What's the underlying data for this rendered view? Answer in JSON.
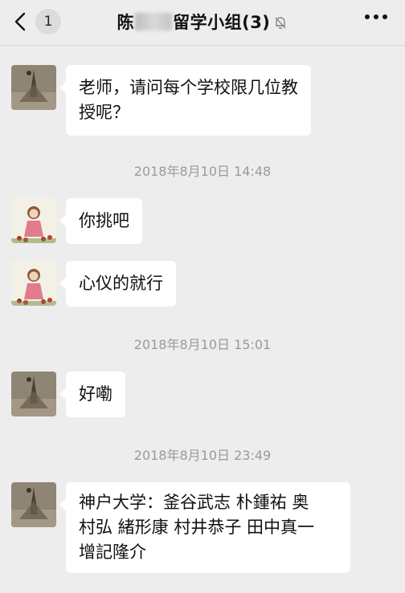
{
  "navbar": {
    "unread_count": "1",
    "title_prefix": "陈",
    "title_suffix": "留学小组(3)"
  },
  "timestamps": [
    "2018年8月10日 14:48",
    "2018年8月10日 15:01",
    "2018年8月10日 23:49"
  ],
  "messages": [
    {
      "sender": "teacher",
      "text_lines": [
        "老师，请问每个学校限几位教",
        "授呢？"
      ]
    },
    {
      "sender": "student",
      "text_lines": [
        "你挑吧"
      ]
    },
    {
      "sender": "student",
      "text_lines": [
        "心仪的就行"
      ]
    },
    {
      "sender": "teacher",
      "text_lines": [
        "好嘞"
      ]
    },
    {
      "sender": "teacher",
      "text_lines": [
        "神户大学：釜谷武志 朴鍾祐 奥",
        "村弘 緒形康 村井恭子 田中真一",
        "增記隆介"
      ]
    }
  ]
}
